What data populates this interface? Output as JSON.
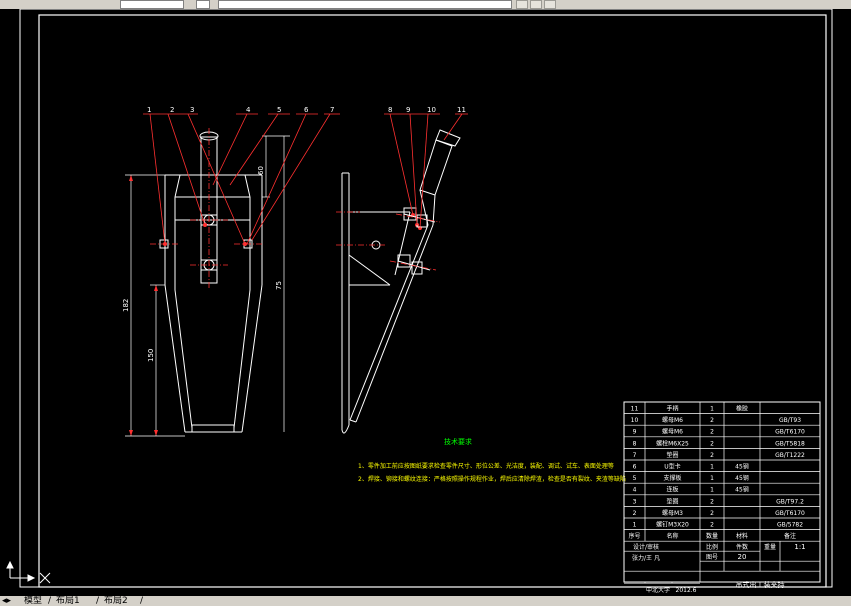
{
  "tabs": {
    "model": "模型",
    "layout1": "布局1",
    "layout2": "布局2"
  },
  "balloons": [
    "1",
    "2",
    "3",
    "4",
    "5",
    "6",
    "7",
    "8",
    "9",
    "10",
    "11"
  ],
  "dims": {
    "d1": "182",
    "d2": "150",
    "d3": "75",
    "d4": "60"
  },
  "tech": {
    "title": "技术要求",
    "line1": "1、零件加工前应按图纸要求检查零件尺寸、形位公差、光洁度，装配、调试、试车、表面处理等",
    "line2": "2、焊接、铆接和螺纹连接：严格按照操作规程作业，焊后应清除焊渣，检查是否有裂纹、夹渣等缺陷"
  },
  "bom": [
    {
      "no": "11",
      "name": "手柄",
      "qty": "1",
      "mat": "橡胶",
      "std": ""
    },
    {
      "no": "10",
      "name": "螺母M6",
      "qty": "2",
      "mat": "",
      "std": "GB/T93"
    },
    {
      "no": "9",
      "name": "螺母M6",
      "qty": "2",
      "mat": "",
      "std": "GB/T6170"
    },
    {
      "no": "8",
      "name": "螺栓M6X25",
      "qty": "2",
      "mat": "",
      "std": "GB/T5818"
    },
    {
      "no": "7",
      "name": "垫圈",
      "qty": "2",
      "mat": "",
      "std": "GB/T1222"
    },
    {
      "no": "6",
      "name": "U型卡",
      "qty": "1",
      "mat": "45钢",
      "std": ""
    },
    {
      "no": "5",
      "name": "支撑板",
      "qty": "1",
      "mat": "45钢",
      "std": ""
    },
    {
      "no": "4",
      "name": "连板",
      "qty": "1",
      "mat": "45钢",
      "std": ""
    },
    {
      "no": "3",
      "name": "垫圈",
      "qty": "2",
      "mat": "",
      "std": "GB/T97.2"
    },
    {
      "no": "2",
      "name": "螺母M3",
      "qty": "2",
      "mat": "",
      "std": "GB/T6170"
    },
    {
      "no": "1",
      "name": "螺钉M3X20",
      "qty": "2",
      "mat": "",
      "std": "GB/5782"
    }
  ],
  "header": {
    "no": "序号",
    "name": "名称",
    "qty": "数量",
    "mat": "材料",
    "std": "备注"
  },
  "title_block": {
    "designer": "张力/王 凡",
    "design_label": "设计/审核",
    "ratio_label": "比例",
    "ratio": "1:1",
    "sheet_label": "图号",
    "count": "20",
    "part_label": "件数",
    "weight_label": "重量",
    "date": "2012.6",
    "school": "中北大学",
    "drawing_title": "吊式出工装夹持"
  }
}
